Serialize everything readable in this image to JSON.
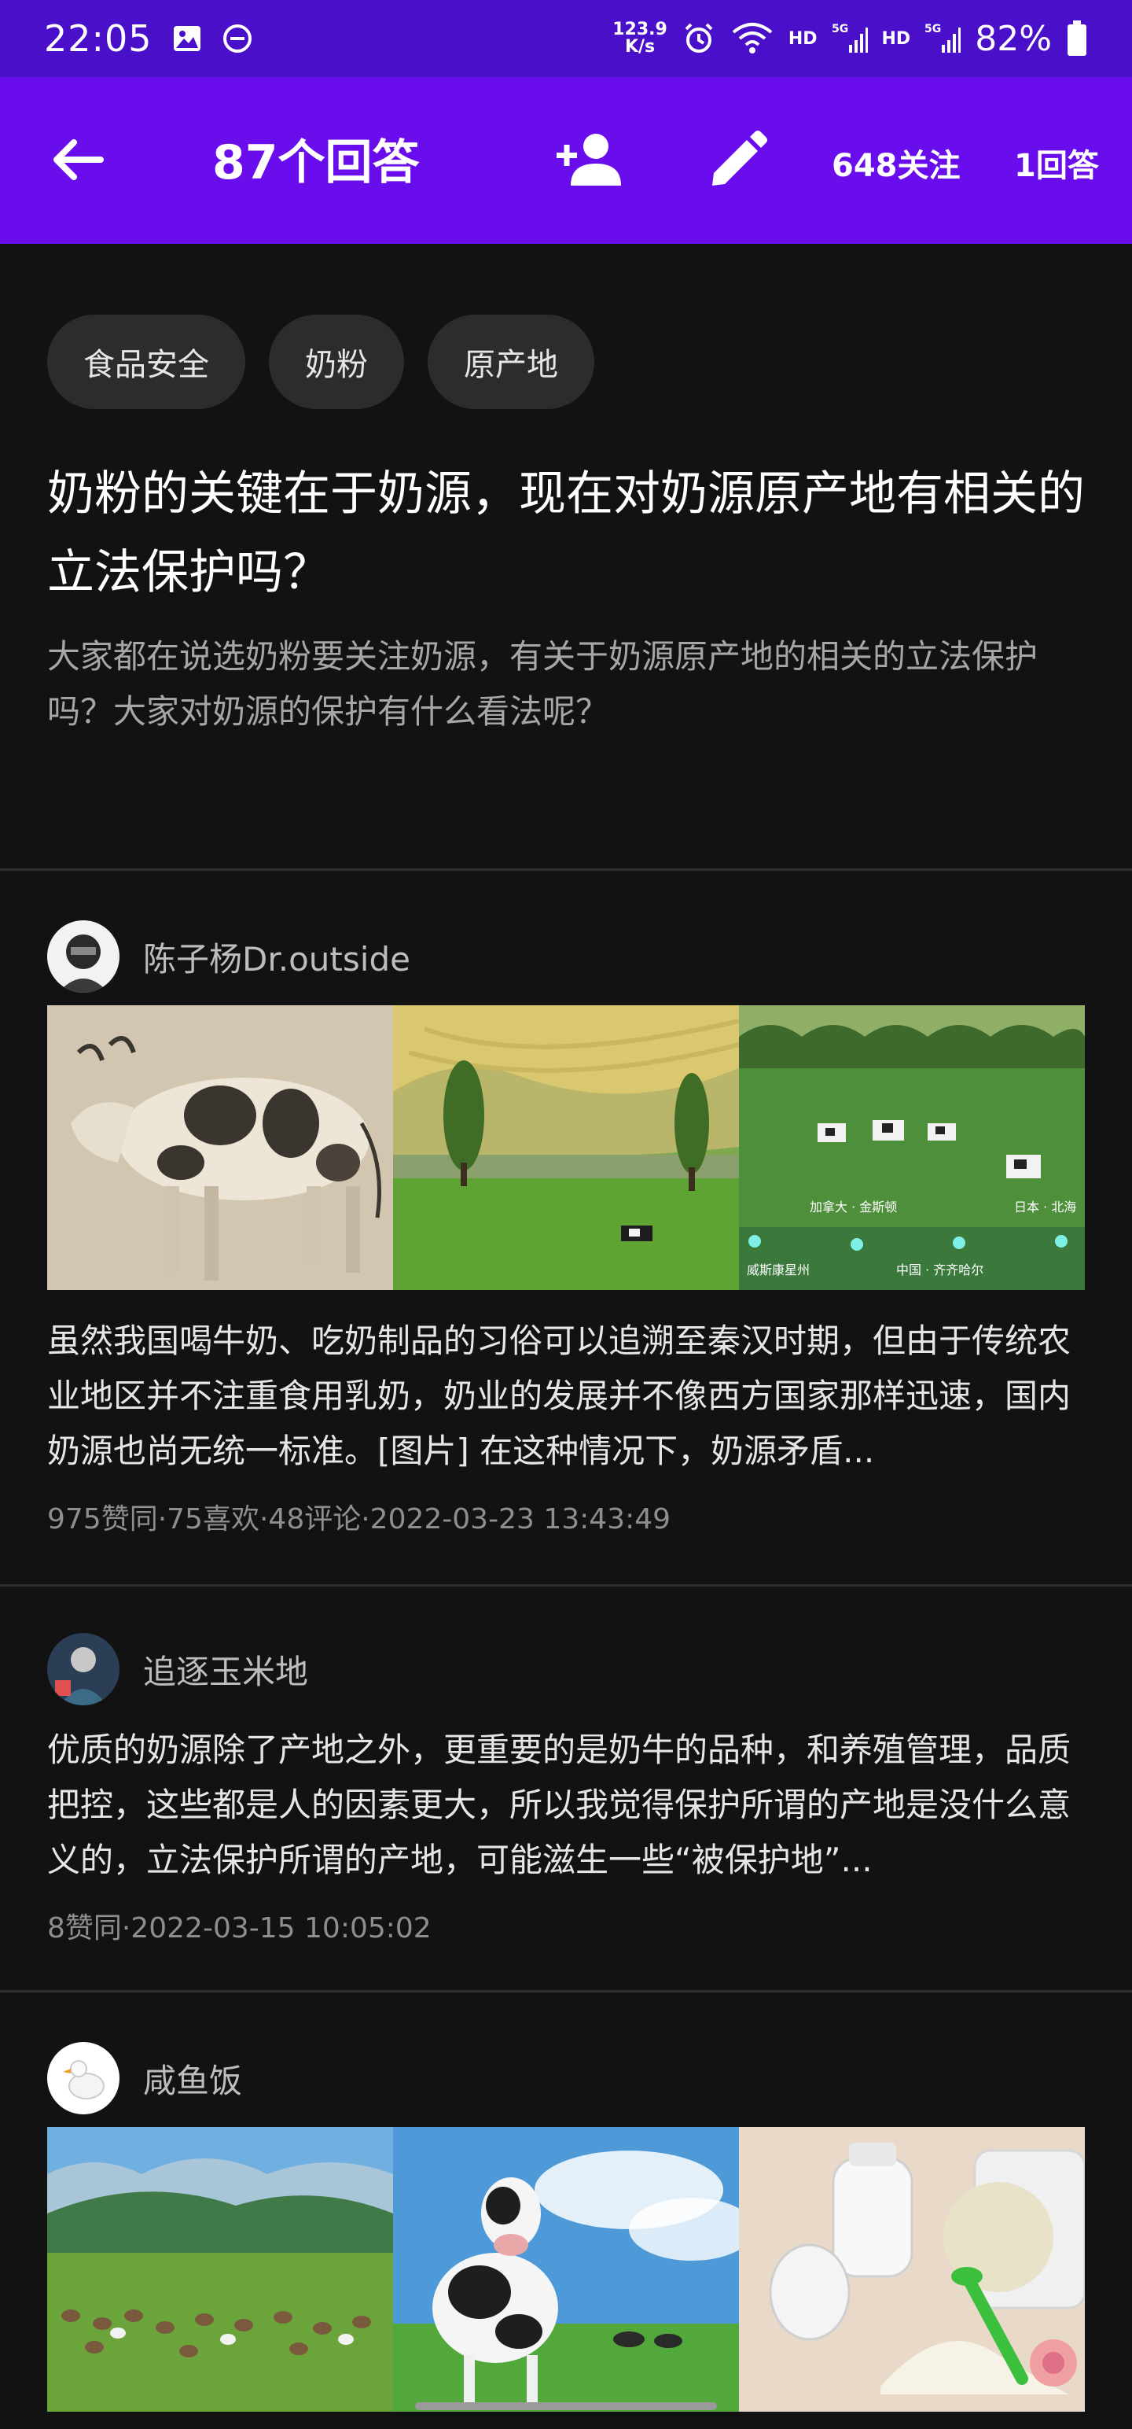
{
  "status_bar": {
    "time": "22:05",
    "net_speed_value": "123.9",
    "net_speed_unit": "K/s",
    "hd1": "HD",
    "hd2": "HD",
    "signal_label": "5G",
    "battery": "82%"
  },
  "header": {
    "title": "87个回答",
    "follow_count": "648关注",
    "answer_count": "1回答"
  },
  "question": {
    "tags": [
      "食品安全",
      "奶粉",
      "原产地"
    ],
    "title": "奶粉的关键在于奶源，现在对奶源原产地有相关的立法保护吗？",
    "description": "大家都在说选奶粉要关注奶源，有关于奶源原产地的相关的立法保护吗？大家对奶源的保护有什么看法呢？"
  },
  "answers": [
    {
      "author": "陈子杨Dr.outside",
      "text": "虽然我国喝牛奶、吃奶制品的习俗可以追溯至秦汉时期，但由于传统农业地区并不注重食用乳奶，奶业的发展并不像西方国家那样迅速，国内奶源也尚无统一标准。[图片] 在这种情况下，奶源矛盾...",
      "meta": "975赞同·75喜欢·48评论·2022-03-23 13:43:49",
      "map_labels": {
        "canada": "加拿大 · 金斯顿",
        "japan": "日本 · 北海",
        "wisconsin": "威斯康星州",
        "china": "中国 · 齐齐哈尔"
      }
    },
    {
      "author": "追逐玉米地",
      "text": "优质的奶源除了产地之外，更重要的是奶牛的品种，和养殖管理，品质把控，这些都是人的因素更大，所以我觉得保护所谓的产地是没什么意义的，立法保护所谓的产地，可能滋生一些“被保护地”...",
      "meta": "8赞同·2022-03-15 10:05:02"
    },
    {
      "author": "咸鱼饭"
    }
  ],
  "colors": {
    "status_bar_bg": "#4a0fc9",
    "header_bg": "#6a0dec",
    "page_bg": "#121212"
  }
}
